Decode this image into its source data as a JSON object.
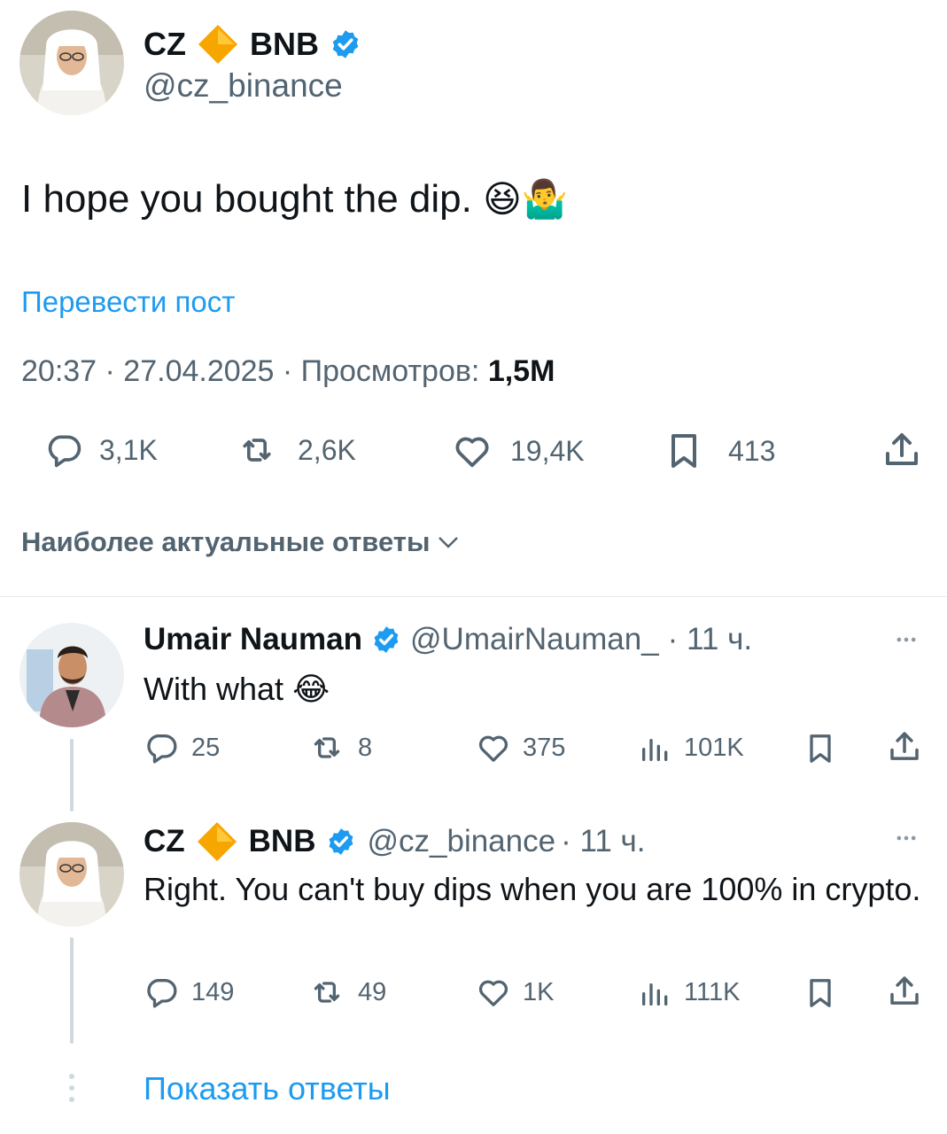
{
  "main_tweet": {
    "display_name": "CZ",
    "display_name_suffix": "BNB",
    "handle": "@cz_binance",
    "text": "I hope you bought the dip.",
    "emoji": "😆🤷‍♂️",
    "translate_link": "Перевести пост",
    "meta_time_date": "20:37 · 27.04.2025 · Просмотров: ",
    "views": "1,5M",
    "stats": {
      "replies": "3,1K",
      "reposts": "2,6K",
      "likes": "19,4K",
      "bookmarks": "413"
    }
  },
  "sort_label": "Наиболее актуальные ответы",
  "replies": [
    {
      "display_name": "Umair Nauman",
      "handle": "@UmairNauman_",
      "time": "· 11 ч.",
      "text": "With what",
      "emoji": "😂",
      "stats": {
        "replies": "25",
        "reposts": "8",
        "likes": "375",
        "views": "101K"
      }
    },
    {
      "display_name": "CZ",
      "display_name_suffix": "BNB",
      "handle": "@cz_binance",
      "time": "· 11 ч.",
      "text": "Right. You can't buy dips when you are 100% in crypto.",
      "stats": {
        "replies": "149",
        "reposts": "49",
        "likes": "1K",
        "views": "111K"
      }
    }
  ],
  "show_replies_label": "Показать ответы",
  "colors": {
    "accent": "#1d9bf0",
    "secondary_text": "#536471",
    "bnb": "#f3ba2f",
    "verified": "#1d9bf0"
  }
}
